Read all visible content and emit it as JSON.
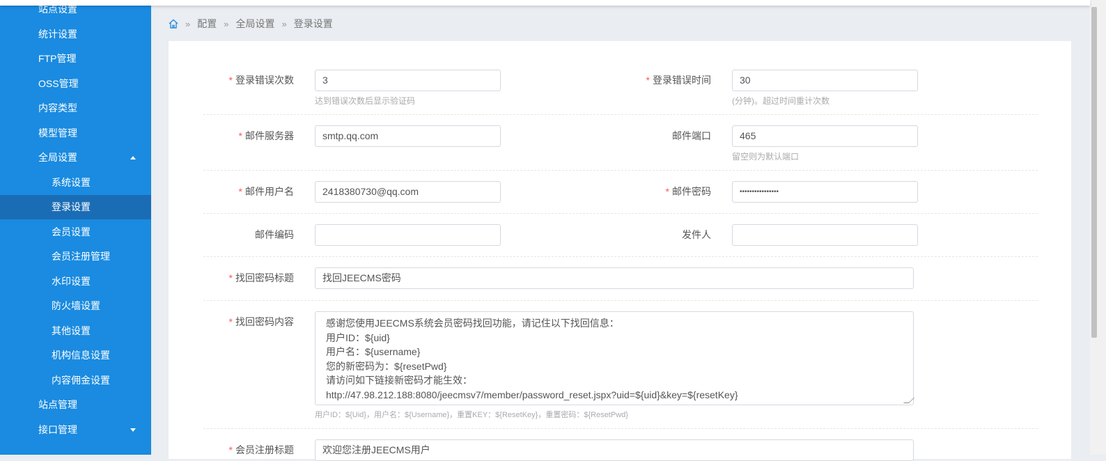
{
  "sidebar": {
    "items": [
      {
        "label": "站点设置"
      },
      {
        "label": "统计设置"
      },
      {
        "label": "FTP管理"
      },
      {
        "label": "OSS管理"
      },
      {
        "label": "内容类型"
      },
      {
        "label": "模型管理"
      },
      {
        "label": "全局设置"
      },
      {
        "label": "系统设置"
      },
      {
        "label": "登录设置"
      },
      {
        "label": "会员设置"
      },
      {
        "label": "会员注册管理"
      },
      {
        "label": "水印设置"
      },
      {
        "label": "防火墙设置"
      },
      {
        "label": "其他设置"
      },
      {
        "label": "机构信息设置"
      },
      {
        "label": "内容佣金设置"
      },
      {
        "label": "站点管理"
      },
      {
        "label": "接口管理"
      }
    ]
  },
  "breadcrumb": [
    "配置",
    "全局设置",
    "登录设置"
  ],
  "form": {
    "login_error_count": {
      "label": "登录错误次数",
      "value": "3",
      "hint": "达到错误次数后显示验证码"
    },
    "login_error_time": {
      "label": "登录错误时间",
      "value": "30",
      "hint": "(分钟)。超过时间重计次数"
    },
    "mail_server": {
      "label": "邮件服务器",
      "value": "smtp.qq.com"
    },
    "mail_port": {
      "label": "邮件端口",
      "value": "465",
      "hint": "留空则为默认端口"
    },
    "mail_user": {
      "label": "邮件用户名",
      "value": "2418380730@qq.com"
    },
    "mail_password": {
      "label": "邮件密码",
      "value": "••••••••••••••••"
    },
    "mail_encoding": {
      "label": "邮件编码",
      "value": ""
    },
    "sender": {
      "label": "发件人",
      "value": ""
    },
    "reset_title": {
      "label": "找回密码标题",
      "value": "找回JEECMS密码"
    },
    "reset_content": {
      "label": "找回密码内容",
      "value": "感谢您使用JEECMS系统会员密码找回功能，请记住以下找回信息：\n用户ID：${uid}\n用户名：${username}\n您的新密码为：${resetPwd}\n请访问如下链接新密码才能生效：\nhttp://47.98.212.188:8080/jeecmsv7/member/password_reset.jspx?uid=${uid}&key=${resetKey}",
      "hint": "用户ID：${Uid}，用户名：${Username}，重置KEY：${ResetKey}，重置密码：${ResetPwd}"
    },
    "register_title": {
      "label": "会员注册标题",
      "value": "欢迎您注册JEECMS用户"
    }
  }
}
